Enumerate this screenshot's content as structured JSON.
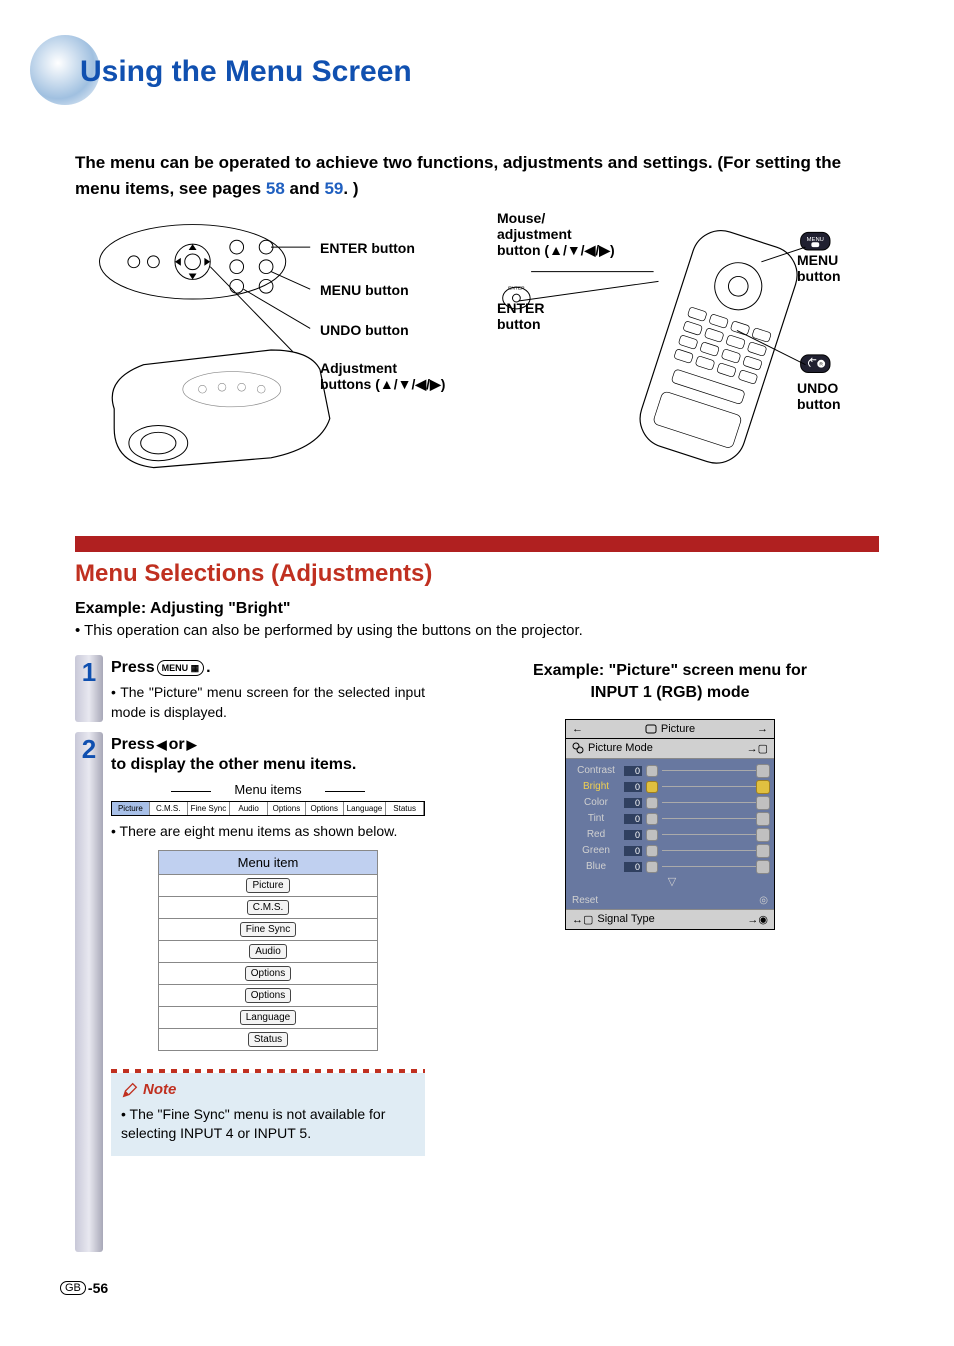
{
  "page": {
    "title": "Using the Menu Screen",
    "intro_prefix": "The menu can be operated to achieve two functions, adjustments and settings. (For setting the menu items, see pages ",
    "intro_link1": "58",
    "intro_mid": " and ",
    "intro_link2": "59",
    "intro_suffix": ". )",
    "page_number": "-56",
    "region": "GB"
  },
  "diagram_projector": {
    "enter": "ENTER button",
    "menu": "MENU button",
    "undo": "UNDO button",
    "adj_line1": "Adjustment",
    "adj_line2": "buttons (▲/▼/◀/▶)"
  },
  "diagram_remote": {
    "mouse_line1": "Mouse/",
    "mouse_line2": "adjustment",
    "mouse_line3": "button (▲/▼/◀/▶)",
    "enter_line1": "ENTER",
    "enter_line2": "button",
    "menu": "MENU button",
    "undo": "UNDO button"
  },
  "section": {
    "title": "Menu Selections (Adjustments)",
    "example_heading": "Example: Adjusting \"Bright\"",
    "example_sub": "• This operation can also be performed by using the buttons on the projector."
  },
  "step1": {
    "num": "1",
    "heading_prefix": "Press ",
    "button_label": "MENU",
    "heading_suffix": ".",
    "desc": "• The \"Picture\" menu screen for the selected input mode is displayed."
  },
  "step2": {
    "num": "2",
    "heading_prefix": "Press ",
    "heading_mid": " or ",
    "heading_suffix": " to display the other menu items.",
    "menu_items_label": "Menu items",
    "strip": [
      "Picture",
      "C.M.S.",
      "Fine Sync",
      "Audio",
      "Options",
      "Options",
      "Language",
      "Status"
    ],
    "list_intro": "• There are eight menu items as shown below.",
    "table_header": "Menu item",
    "table_rows": [
      "Picture",
      "C.M.S.",
      "Fine Sync",
      "Audio",
      "Options",
      "Options",
      "Language",
      "Status"
    ]
  },
  "note": {
    "title": "Note",
    "text": "• The \"Fine Sync\" menu is not available for selecting INPUT 4 or INPUT 5."
  },
  "example_right": {
    "title_line1": "Example: \"Picture\" screen menu for",
    "title_line2": "INPUT 1 (RGB) mode"
  },
  "osd": {
    "tab": "Picture",
    "mode": "Picture Mode",
    "rows": [
      {
        "label": "Contrast",
        "val": "0",
        "active": false
      },
      {
        "label": "Bright",
        "val": "0",
        "active": true
      },
      {
        "label": "Color",
        "val": "0",
        "active": false
      },
      {
        "label": "Tint",
        "val": "0",
        "active": false
      },
      {
        "label": "Red",
        "val": "0",
        "active": false
      },
      {
        "label": "Green",
        "val": "0",
        "active": false
      },
      {
        "label": "Blue",
        "val": "0",
        "active": false
      }
    ],
    "reset": "Reset",
    "signal": "Signal Type"
  }
}
